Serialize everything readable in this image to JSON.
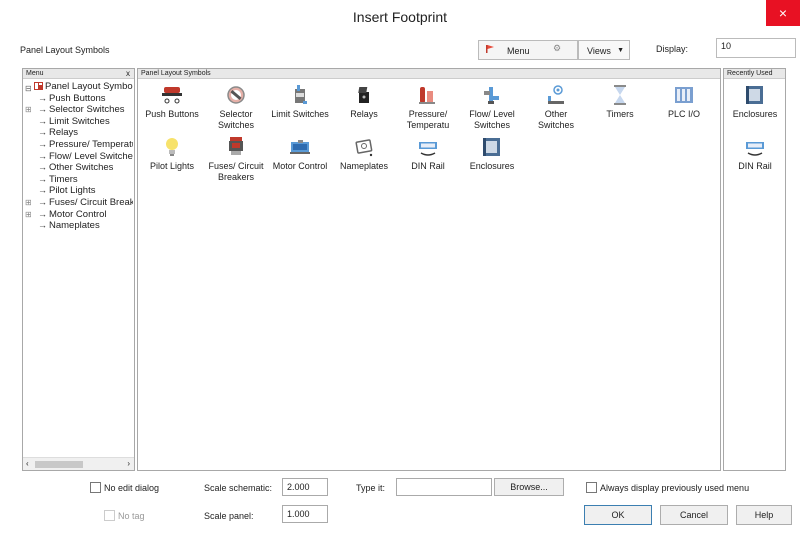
{
  "window": {
    "title": "Insert Footprint",
    "close_glyph": "×"
  },
  "toolbar": {
    "label": "Panel Layout Symbols",
    "menu_label": "Menu",
    "views_label": "Views",
    "display_label": "Display:",
    "display_value": "10"
  },
  "menu_pane": {
    "header": "Menu",
    "close_glyph": "x",
    "root": "Panel Layout Symbols",
    "items": [
      {
        "label": "Push Buttons",
        "expandable": false
      },
      {
        "label": "Selector Switches",
        "expandable": true
      },
      {
        "label": "Limit Switches",
        "expandable": false
      },
      {
        "label": "Relays",
        "expandable": false
      },
      {
        "label": "Pressure/ Temperature",
        "expandable": false
      },
      {
        "label": "Flow/ Level Switches",
        "expandable": false
      },
      {
        "label": "Other Switches",
        "expandable": false
      },
      {
        "label": "Timers",
        "expandable": false
      },
      {
        "label": "Pilot Lights",
        "expandable": false
      },
      {
        "label": "Fuses/ Circuit Breakers",
        "expandable": true
      },
      {
        "label": "Motor Control",
        "expandable": true
      },
      {
        "label": "Nameplates",
        "expandable": false
      }
    ]
  },
  "symbols_pane": {
    "header": "Panel Layout Symbols",
    "tiles": [
      {
        "line1": "Push Buttons",
        "line2": "",
        "icon": "push-buttons-icon"
      },
      {
        "line1": "Selector",
        "line2": "Switches",
        "icon": "selector-switches-icon"
      },
      {
        "line1": "Limit Switches",
        "line2": "",
        "icon": "limit-switches-icon"
      },
      {
        "line1": "Relays",
        "line2": "",
        "icon": "relays-icon"
      },
      {
        "line1": "Pressure/",
        "line2": "Temperatu",
        "icon": "pressure-temperature-icon"
      },
      {
        "line1": "Flow/ Level",
        "line2": "Switches",
        "icon": "flow-level-switches-icon"
      },
      {
        "line1": "Other",
        "line2": "Switches",
        "icon": "other-switches-icon"
      },
      {
        "line1": "Timers",
        "line2": "",
        "icon": "timers-icon"
      },
      {
        "line1": "PLC I/O",
        "line2": "",
        "icon": "plc-io-icon"
      },
      {
        "line1": "Pilot Lights",
        "line2": "",
        "icon": "pilot-lights-icon"
      },
      {
        "line1": "Fuses/ Circuit",
        "line2": "Breakers",
        "icon": "fuses-circuit-breakers-icon"
      },
      {
        "line1": "Motor Control",
        "line2": "",
        "icon": "motor-control-icon"
      },
      {
        "line1": "Nameplates",
        "line2": "",
        "icon": "nameplates-icon"
      },
      {
        "line1": "DIN Rail",
        "line2": "",
        "icon": "din-rail-icon"
      },
      {
        "line1": "Enclosures",
        "line2": "",
        "icon": "enclosures-icon"
      }
    ]
  },
  "recent_pane": {
    "header": "Recently Used",
    "tiles": [
      {
        "line1": "Enclosures",
        "icon": "enclosures-icon"
      },
      {
        "line1": "DIN Rail",
        "icon": "din-rail-icon"
      }
    ]
  },
  "bottom": {
    "no_edit_dialog": "No edit dialog",
    "no_tag": "No tag",
    "scale_schematic_label": "Scale schematic:",
    "scale_schematic_value": "2.000",
    "scale_panel_label": "Scale panel:",
    "scale_panel_value": "1.000",
    "type_it_label": "Type it:",
    "type_it_value": "",
    "browse": "Browse...",
    "always_display": "Always display previously used menu",
    "ok": "OK",
    "cancel": "Cancel",
    "help": "Help"
  }
}
